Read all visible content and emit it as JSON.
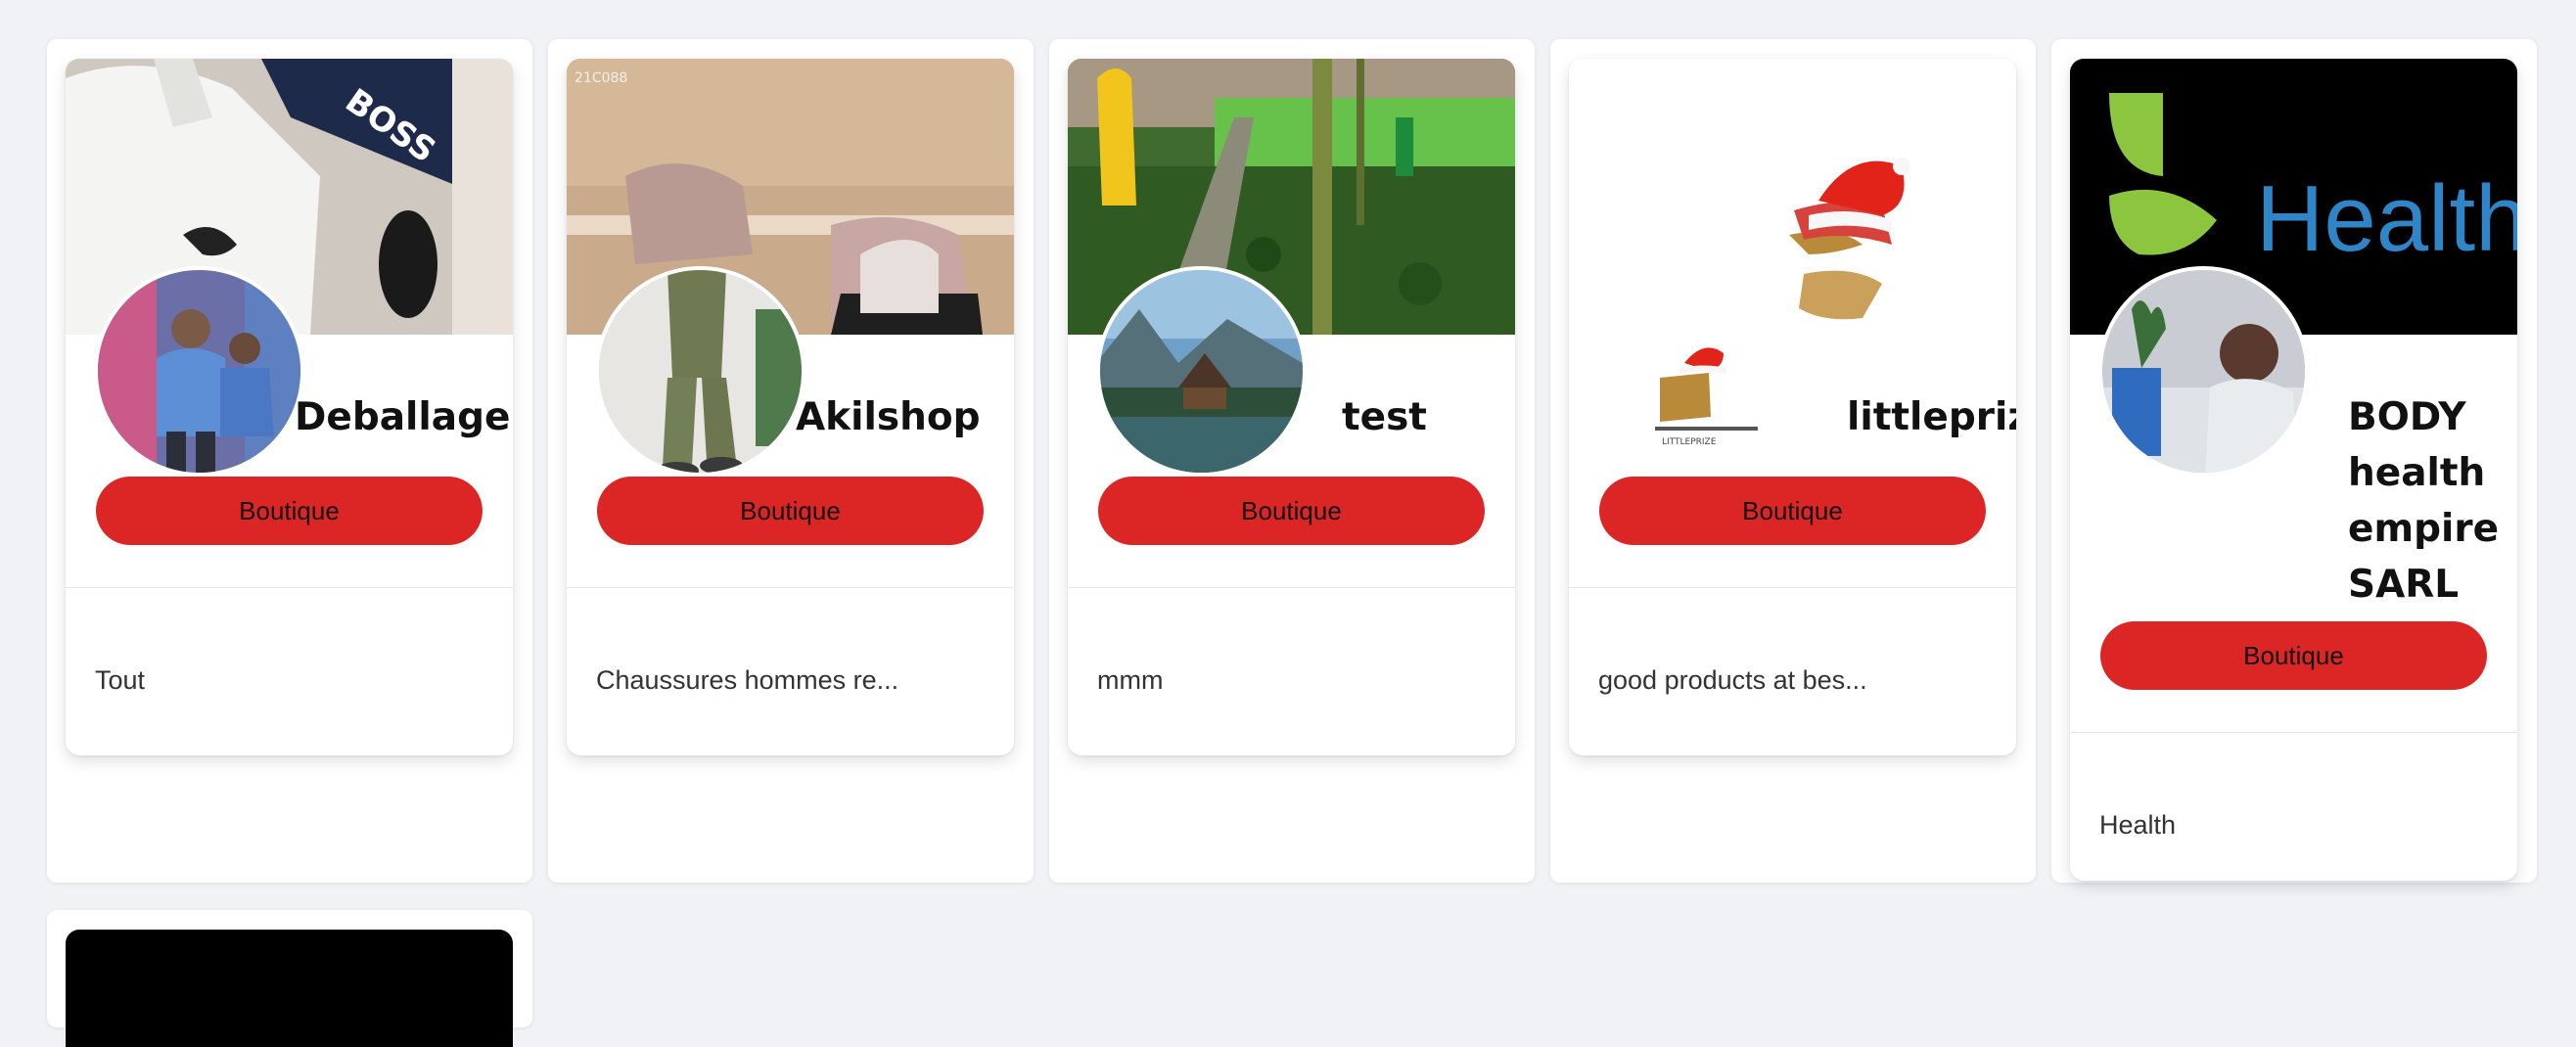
{
  "shops": [
    {
      "name": "Deballage",
      "button": "Boutique",
      "description": "Tout"
    },
    {
      "name": "Akilshop",
      "button": "Boutique",
      "description": "Chaussures hommes re..."
    },
    {
      "name": "test",
      "button": "Boutique",
      "description": "mmm"
    },
    {
      "name": "littleprize",
      "button": "Boutique",
      "description": "good products at bes..."
    },
    {
      "name": "BODY health empire SARL",
      "button": "Boutique",
      "description": "Health"
    }
  ],
  "banner_text": {
    "boss": "BOSS",
    "code": "21C088",
    "health": "Health",
    "lp_small": "LITTLEPRIZE"
  },
  "colors": {
    "button": "#dc2626",
    "page_bg": "#f0f2f6",
    "card_bg": "#ffffff"
  }
}
